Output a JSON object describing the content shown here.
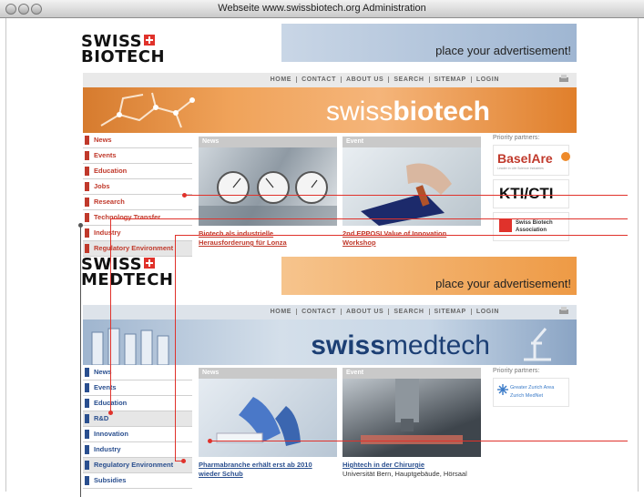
{
  "window": {
    "title": "Webseite www.swissbiotech.org Administration"
  },
  "colors": {
    "bio_red": "#c0392b",
    "med_blue": "#2a4f8f",
    "accent_orange": "#ee9a45",
    "swiss_red": "#e0322b"
  },
  "bio": {
    "logo_top": "SWISS",
    "logo_bottom": "BIOTECH",
    "ad_text": "place your advertisement!",
    "nav": [
      "HOME",
      "CONTACT",
      "ABOUT US",
      "SEARCH",
      "SITEMAP",
      "LOGIN"
    ],
    "hero_light": "swiss",
    "hero_bold": "biotech",
    "sidebar": [
      "News",
      "Events",
      "Education",
      "Jobs",
      "Research",
      "Technology Transfer",
      "Industry",
      "Regulatory Environment"
    ],
    "news": {
      "head": "News",
      "link_line1": "Biotech als industrielle",
      "link_line2": "Herausforderung für Lonza"
    },
    "event": {
      "head": "Event",
      "link_line1": "2nd EPPOSI Value of Innovation",
      "link_line2": "Workshop"
    },
    "partners_head": "Priority partners:",
    "partner_basel": "BaselAre",
    "partner_basel_sub": "Leader in Life Science Industries",
    "partner_kti": "KTI/CTI",
    "partner_sba_line1": "Swiss Biotech",
    "partner_sba_line2": "Association"
  },
  "med": {
    "logo_top": "SWISS",
    "logo_bottom": "MEDTECH",
    "ad_text": "place your advertisement!",
    "nav": [
      "HOME",
      "CONTACT",
      "ABOUT US",
      "SEARCH",
      "SITEMAP",
      "LOGIN"
    ],
    "hero_bold": "swiss",
    "hero_light": "medtech",
    "sidebar": [
      "News",
      "Events",
      "Education",
      "R&D",
      "Innovation",
      "Industry",
      "Regulatory Environment",
      "Subsidies"
    ],
    "news": {
      "head": "News",
      "link_line1": "Pharmabranche erhält erst ab 2010",
      "link_line2": "wieder Schub"
    },
    "event": {
      "head": "Event",
      "link_line1": "Hightech in der Chirurgie",
      "sub": "Universität Bern, Hauptgebäude, Hörsaal"
    },
    "partners_head": "Priority partners:",
    "partner_gza_line1": "Greater Zurich Area",
    "partner_gza_line2": "Zurich MedNet"
  }
}
